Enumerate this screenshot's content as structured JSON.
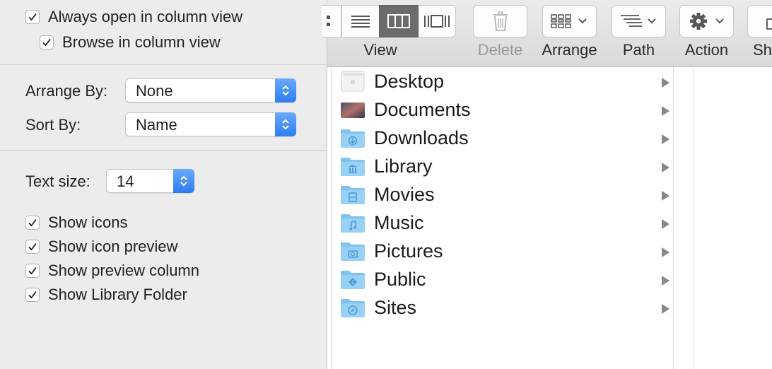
{
  "options": {
    "always_open_column": {
      "label": "Always open in column view",
      "checked": true
    },
    "browse_column": {
      "label": "Browse in column view",
      "checked": true
    },
    "arrange_by": {
      "label": "Arrange By:",
      "value": "None"
    },
    "sort_by": {
      "label": "Sort By:",
      "value": "Name"
    },
    "text_size": {
      "label": "Text size:",
      "value": "14"
    },
    "show_icons": {
      "label": "Show icons",
      "checked": true
    },
    "show_icon_preview": {
      "label": "Show icon preview",
      "checked": true
    },
    "show_preview_column": {
      "label": "Show preview column",
      "checked": true
    },
    "show_library_folder": {
      "label": "Show Library Folder",
      "checked": true
    }
  },
  "toolbar": {
    "view_label": "View",
    "delete_label": "Delete",
    "arrange_label": "Arrange",
    "path_label": "Path",
    "action_label": "Action",
    "share_label": "Sh"
  },
  "files": [
    {
      "name": "Desktop",
      "icon": "desktop-folder-icon"
    },
    {
      "name": "Documents",
      "icon": "documents-folder-icon"
    },
    {
      "name": "Downloads",
      "icon": "downloads-folder-icon"
    },
    {
      "name": "Library",
      "icon": "library-folder-icon"
    },
    {
      "name": "Movies",
      "icon": "movies-folder-icon"
    },
    {
      "name": "Music",
      "icon": "music-folder-icon"
    },
    {
      "name": "Pictures",
      "icon": "pictures-folder-icon"
    },
    {
      "name": "Public",
      "icon": "public-folder-icon"
    },
    {
      "name": "Sites",
      "icon": "sites-folder-icon"
    }
  ],
  "colors": {
    "accent": "#2d7cf2",
    "folder": "#7fc3f0",
    "panel_bg": "#ececec",
    "selected_segment": "#6b6b6b"
  }
}
